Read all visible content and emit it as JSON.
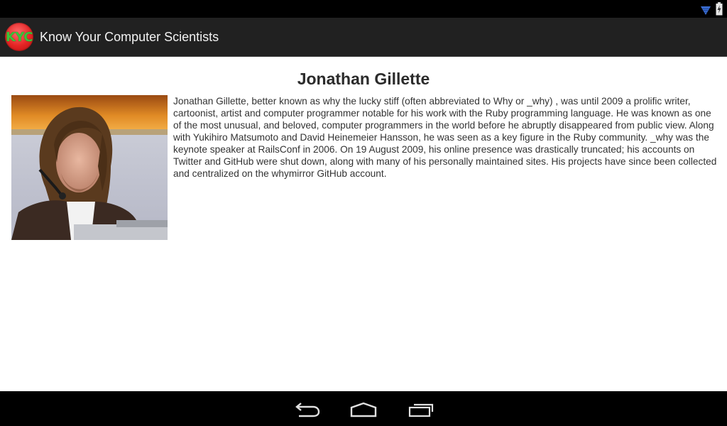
{
  "app": {
    "title": "Know Your Computer Scientists",
    "logo_text": "KYC"
  },
  "scientist": {
    "name": "Jonathan Gillette",
    "bio": "Jonathan Gillette, better known as why the lucky stiff (often abbreviated to Why or _why) , was until 2009 a prolific writer, cartoonist, artist and computer programmer notable for his work with the Ruby programming language. He was known as one of the most unusual, and beloved, computer programmers in the world before he abruptly disappeared from public view. Along with Yukihiro Matsumoto and David Heinemeier Hansson, he was seen as a key figure in the Ruby community. _why was the keynote speaker at RailsConf in 2006. On 19 August 2009, his online presence was drastically truncated; his accounts on Twitter and GitHub were shut down, along with many of his personally maintained sites. His projects have since been collected and centralized on the whymirror GitHub account."
  },
  "status_bar": {
    "icons": [
      "wifi-icon",
      "battery-charging-icon"
    ]
  },
  "navigation": {
    "icons": [
      "back-icon",
      "home-icon",
      "recent-apps-icon"
    ]
  },
  "colors": {
    "action_bar": "#212121",
    "system_bars": "#000000",
    "logo_red": "#e42424",
    "logo_text_green": "#3ac33a",
    "wifi_blue": "#3b6fd6"
  }
}
